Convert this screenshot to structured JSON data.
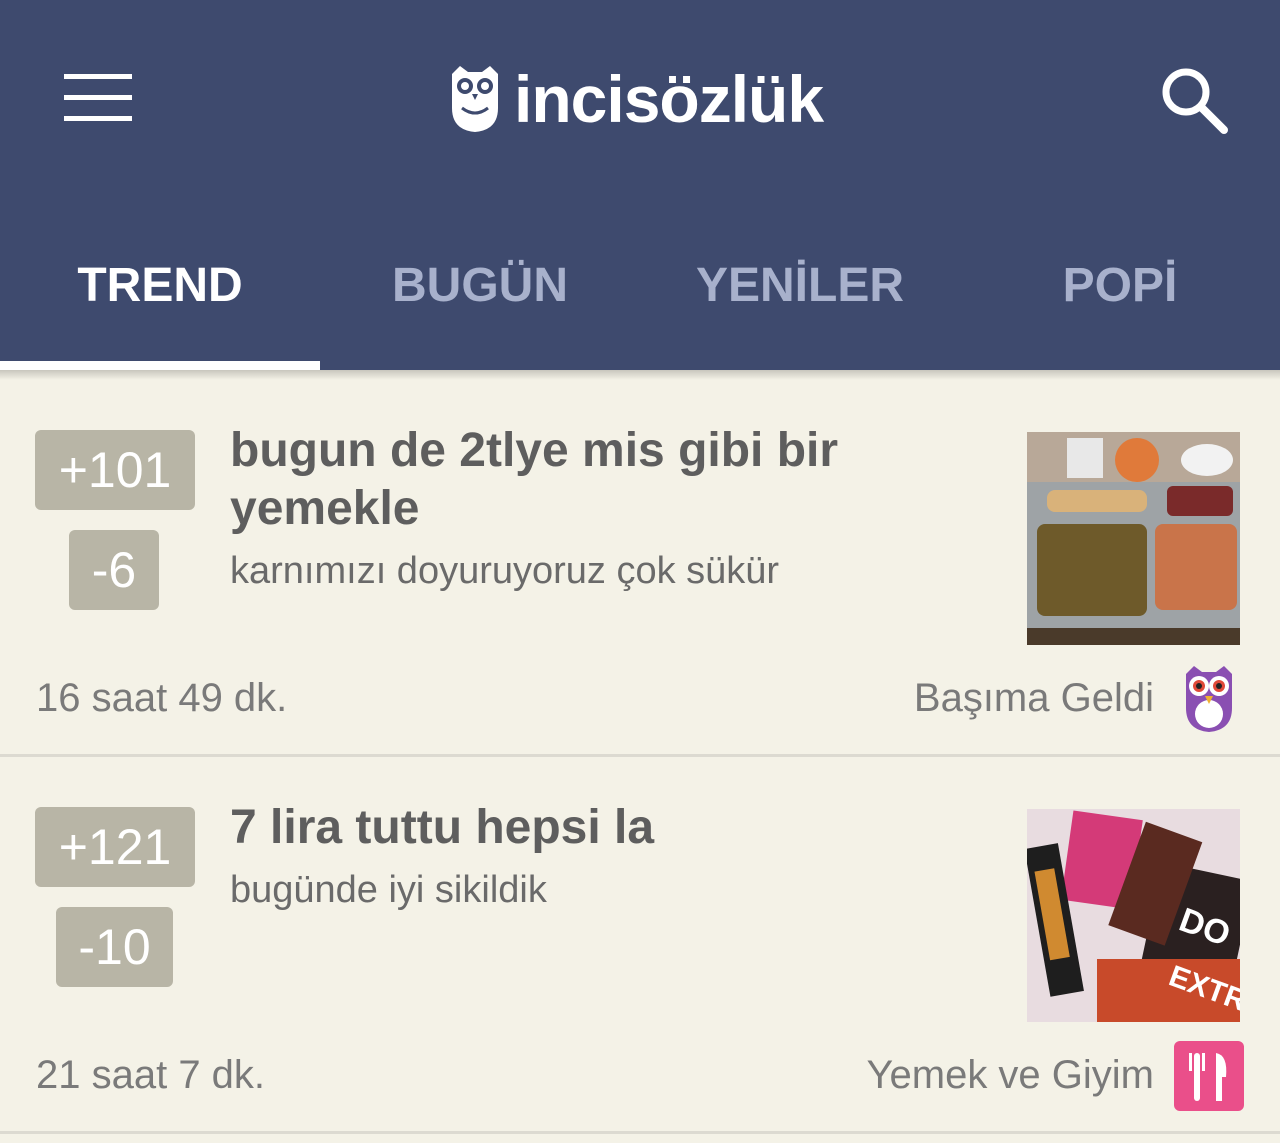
{
  "app": {
    "name": "incisözlük"
  },
  "header": {
    "menu_icon": "hamburger-menu-icon",
    "logo_icon": "owl-icon",
    "search_icon": "search-icon"
  },
  "tabs": [
    {
      "label": "TREND",
      "active": true
    },
    {
      "label": "BUGÜN",
      "active": false
    },
    {
      "label": "YENİLER",
      "active": false
    },
    {
      "label": "POPİ",
      "active": false
    }
  ],
  "colors": {
    "header": "#3e4a6e",
    "background": "#f4f2e7",
    "vote": "#b8b5a6",
    "food_category": "#ea4f8a"
  },
  "posts": [
    {
      "upvotes": "+101",
      "downvotes": "-6",
      "title": "bugun de 2tlye mis gibi bir yemekle",
      "subtitle": "karnımızı doyuruyoruz çok sükür",
      "time": "16 saat 49 dk.",
      "category": "Başıma Geldi",
      "category_icon": "purple-owl-icon",
      "thumbnail": "food-tray-photo"
    },
    {
      "upvotes": "+121",
      "downvotes": "-10",
      "title": "7 lira tuttu hepsi la",
      "subtitle": "bugünde iyi sikildik",
      "time": "21 saat 7 dk.",
      "category": "Yemek ve Giyim",
      "category_icon": "fork-knife-icon",
      "thumbnail": "snacks-photo"
    }
  ]
}
